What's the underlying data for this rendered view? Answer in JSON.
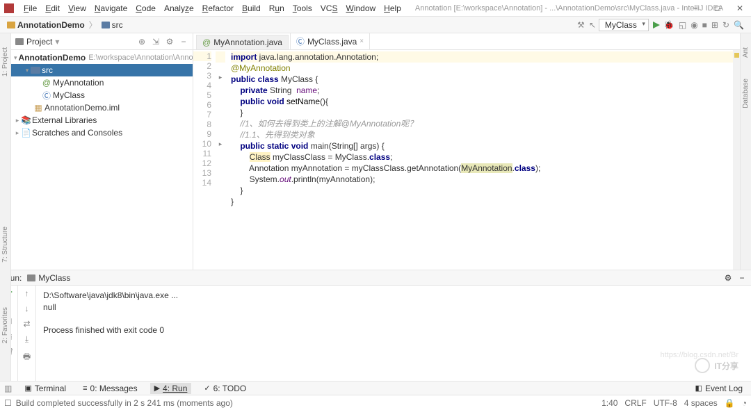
{
  "menubar": {
    "items": [
      "File",
      "Edit",
      "View",
      "Navigate",
      "Code",
      "Analyze",
      "Refactor",
      "Build",
      "Run",
      "Tools",
      "VCS",
      "Window",
      "Help"
    ],
    "title": "Annotation [E:\\workspace\\Annotation] - ...\\AnnotationDemo\\src\\MyClass.java - IntelliJ IDEA"
  },
  "breadcrumb": {
    "root": "AnnotationDemo",
    "child": "src"
  },
  "toolbar": {
    "config": "MyClass"
  },
  "project": {
    "title": "Project",
    "root": {
      "name": "AnnotationDemo",
      "path": "E:\\workspace\\Annotation\\Annotation"
    },
    "src": "src",
    "files": [
      "MyAnnotation",
      "MyClass",
      "AnnotationDemo.iml"
    ],
    "ext": "External Libraries",
    "scratch": "Scratches and Consoles"
  },
  "tabs": [
    {
      "name": "MyAnnotation.java",
      "active": false
    },
    {
      "name": "MyClass.java",
      "active": true
    }
  ],
  "code": {
    "lines": [
      "import java.lang.annotation.Annotation;",
      "@MyAnnotation",
      "public class MyClass {",
      "    private String  name;",
      "    public void setName(){",
      "    }",
      "    //1、如何去得到类上的注解@MyAnnotation呢？",
      "    //1.1、先得到类对象",
      "    public static void main(String[] args) {",
      "        Class myClassClass = MyClass.class;",
      "        Annotation myAnnotation = myClassClass.getAnnotation(MyAnnotation.class);",
      "        System.out.println(myAnnotation);",
      "    }",
      "}"
    ]
  },
  "run": {
    "label": "Run:",
    "config": "MyClass",
    "out1": "D:\\Software\\java\\jdk8\\bin\\java.exe ...",
    "out2": "null",
    "out3": "Process finished with exit code 0"
  },
  "bottomTabs": {
    "terminal": "Terminal",
    "messages": "0: Messages",
    "run": "4: Run",
    "todo": "6: TODO",
    "eventlog": "Event Log"
  },
  "status": {
    "msg": "Build completed successfully in 2 s 241 ms (moments ago)",
    "pos": "1:40",
    "eol": "CRLF",
    "enc": "UTF-8",
    "indent": "4 spaces"
  },
  "rails": {
    "project": "1: Project",
    "favorites": "2: Favorites",
    "structure": "7: Structure",
    "ant": "Ant",
    "database": "Database"
  },
  "watermark": {
    "text": "IT分享",
    "url": "https://blog.csdn.net/Br"
  }
}
